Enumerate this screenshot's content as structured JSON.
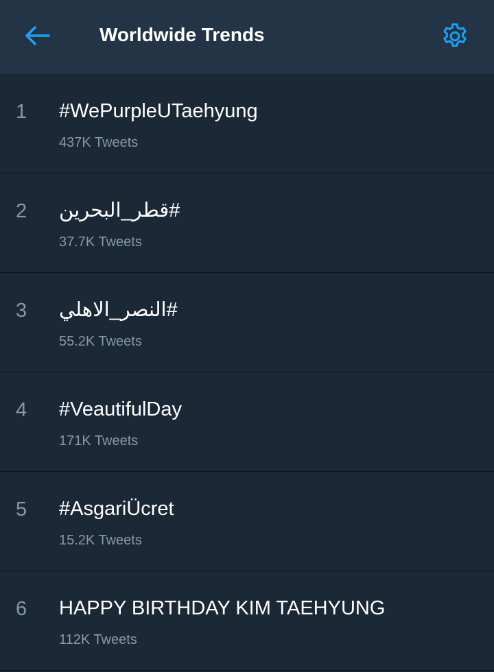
{
  "header": {
    "title": "Worldwide Trends",
    "back_icon": "arrow-left-icon",
    "settings_icon": "gear-icon"
  },
  "colors": {
    "background": "#1b2836",
    "header": "#243447",
    "accent": "#1da1f2",
    "primary_text": "#ffffff",
    "secondary_text": "#8899a6",
    "divider": "#0e151d"
  },
  "trends": [
    {
      "rank": "1",
      "name": "#WePurpleUTaehyung",
      "count": "437K Tweets"
    },
    {
      "rank": "2",
      "name": "#قطر_البحرين",
      "count": "37.7K Tweets"
    },
    {
      "rank": "3",
      "name": "#النصر_الاهلي",
      "count": "55.2K Tweets"
    },
    {
      "rank": "4",
      "name": "#VeautifulDay",
      "count": "171K Tweets"
    },
    {
      "rank": "5",
      "name": "#AsgariÜcret",
      "count": "15.2K Tweets"
    },
    {
      "rank": "6",
      "name": "HAPPY BIRTHDAY KIM TAEHYUNG",
      "count": "112K Tweets"
    }
  ]
}
